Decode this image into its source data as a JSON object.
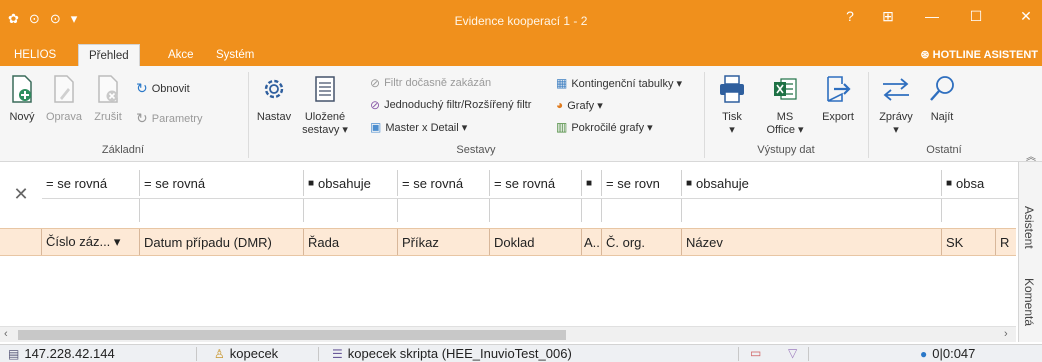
{
  "window": {
    "title": "Evidence kooperací 1 - 2",
    "help": "?",
    "minimize": "—",
    "maximize": "☐",
    "close": "✕"
  },
  "menu": {
    "tabs": [
      "HELIOS",
      "Přehled",
      "Akce",
      "Systém"
    ],
    "active": "Přehled",
    "hotline": "HOTLINE ASISTENT"
  },
  "ribbon": {
    "zakladni": {
      "label": "Základní",
      "novy": "Nový",
      "oprava": "Oprava",
      "zrusit": "Zrušit",
      "obnovit": "Obnovit",
      "parametry": "Parametry"
    },
    "nastav": "Nastav",
    "sestavy": {
      "label": "Sestavy",
      "ulozene_1": "Uložené",
      "ulozene_2": "sestavy ▾",
      "filtr_docasne": "Filtr dočasně zakázán",
      "jednoduchy_filtr": "Jednoduchý filtr/Rozšířený filtr",
      "master_detail": "Master x Detail ▾",
      "kontingencni": "Kontingenční tabulky ▾",
      "grafy": "Grafy ▾",
      "pokrocile_grafy": "Pokročilé grafy ▾"
    },
    "vystupy": {
      "label": "Výstupy dat",
      "tisk": "Tisk",
      "ms_office_1": "MS",
      "ms_office_2": "Office ▾",
      "export": "Export"
    },
    "ostatni": {
      "label": "Ostatní",
      "zpravy": "Zprávy",
      "najit": "Najít"
    }
  },
  "grid": {
    "filters": [
      "= se rovná",
      "= se rovná",
      "obsahuje",
      "= se rovná",
      "= se rovná",
      "",
      "= se rovn",
      "obsahuje",
      "obsa"
    ],
    "columns": [
      "Číslo záz... ▾",
      "Datum případu (DMR)",
      "Řada",
      "Příkaz",
      "Doklad",
      "A...",
      "Č. org.",
      "Název",
      "SK",
      "R"
    ]
  },
  "side_panels": [
    "Asistent",
    "Komentá"
  ],
  "status": {
    "ip": "147.228.42.144",
    "user": "kopecek",
    "db": "kopecek skripta (HEE_InuvioTest_006)",
    "counter": "0|0:047"
  }
}
